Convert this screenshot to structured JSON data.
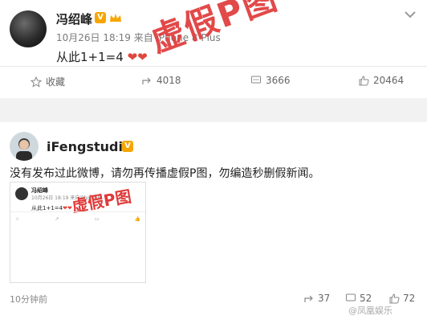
{
  "post1": {
    "username": "冯绍峰",
    "verified_badge": "V",
    "meta": "10月26日 18:19 来自 iPhone 8 Plus",
    "text": "从此1+1=4",
    "stamp": "虚假P图",
    "actions": {
      "favorite_label": "收藏",
      "repost_count": "4018",
      "comment_count": "3666",
      "like_count": "20464"
    }
  },
  "post2": {
    "username": "iFengstudio",
    "verified_badge": "V",
    "text": "没有发布过此微博，请勿再传播虚假P图，勿编造秒删假新闻。",
    "embedded": {
      "username": "冯绍峰",
      "meta": "10月26日 18:19 来自iPhone 8",
      "text": "从此1+1=4",
      "stamp": "虚假P图"
    },
    "time": "10分钟前",
    "repost_count": "37",
    "comment_count": "52",
    "like_count": "72"
  },
  "watermark": "@凤凰娱乐",
  "colors": {
    "stamp_red": "#e03a3a",
    "badge_orange": "#f7a500"
  }
}
